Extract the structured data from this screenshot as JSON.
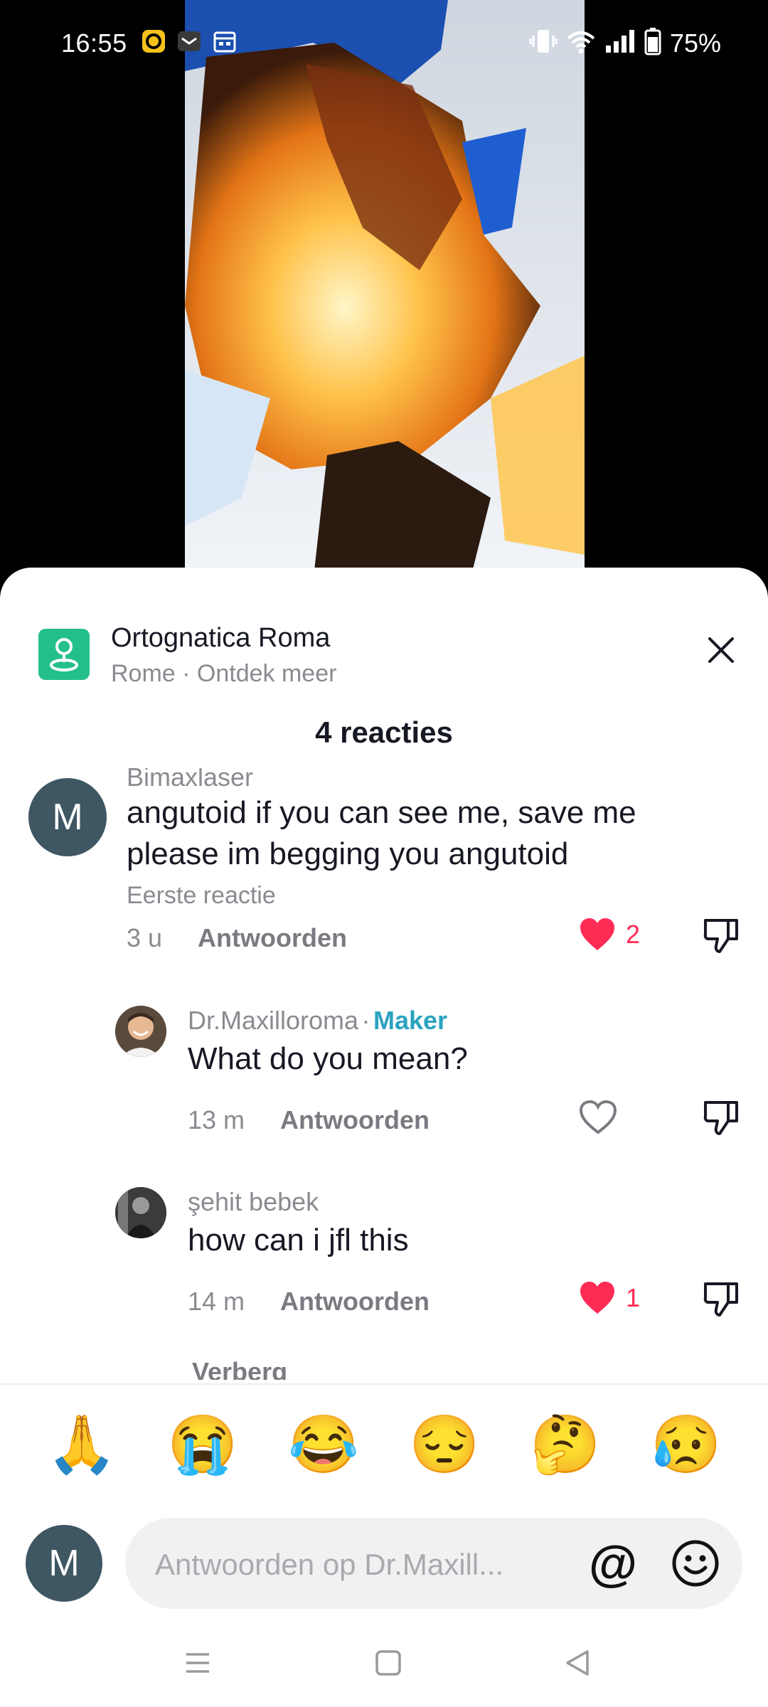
{
  "status_bar": {
    "time": "16:55",
    "battery_text": "75%",
    "icons": [
      "notification-app-icon",
      "mail-icon",
      "calendar-icon",
      "vibrate-icon",
      "wifi-icon",
      "signal-icon",
      "battery-icon"
    ]
  },
  "location": {
    "title": "Ortognatica Roma",
    "subtitle": "Rome · Ontdek meer"
  },
  "comments_count": "4 reacties",
  "comments": [
    {
      "user": "Bimaxlaser",
      "avatar_letter": "M",
      "text_line1": "angutoid if you can see me, save me",
      "text_line2": "please im begging you angutoid",
      "label": "Eerste reactie",
      "time": "3 u",
      "reply": "Antwoorden",
      "likes": "2",
      "liked": true
    },
    {
      "user": "Dr.Maxilloroma",
      "separator": "·",
      "badge": "Maker",
      "text": "What do you mean?",
      "time": "13 m",
      "reply": "Antwoorden",
      "liked": false
    },
    {
      "user": "şehit bebek",
      "text": "how can i jfl this",
      "time": "14 m",
      "reply": "Antwoorden",
      "likes": "1",
      "liked": true
    }
  ],
  "hide_label": "Verberg",
  "emojis": [
    "🙏",
    "😭",
    "😂",
    "😔",
    "🤔",
    "😥"
  ],
  "input": {
    "avatar_letter": "M",
    "placeholder": "Antwoorden op Dr.Maxill...",
    "at_symbol": "@"
  },
  "colors": {
    "like_red": "#fe2c55",
    "maker_blue": "#2aa3bf",
    "location_green": "#24c089",
    "avatar_slate": "#3f5663"
  }
}
